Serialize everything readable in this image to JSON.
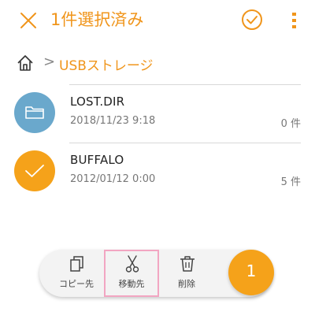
{
  "header": {
    "title": "1件選択済み"
  },
  "breadcrumb": {
    "separator": ">",
    "location": "USBストレージ"
  },
  "files": [
    {
      "name": "LOST.DIR",
      "date": "2018/11/23 9:18",
      "count": "0 件",
      "icon": "folder-icon",
      "selected": false
    },
    {
      "name": "BUFFALO",
      "date": "2012/01/12 0:00",
      "count": "5 件",
      "icon": "check-icon",
      "selected": true
    }
  ],
  "actions": {
    "copy_label": "コピー先",
    "move_label": "移動先",
    "delete_label": "削除"
  },
  "selection_count": "1",
  "colors": {
    "accent": "#f0951b",
    "folder": "#6aa8cc",
    "selected": "#f5a21a",
    "highlight": "#f2a6c2"
  }
}
